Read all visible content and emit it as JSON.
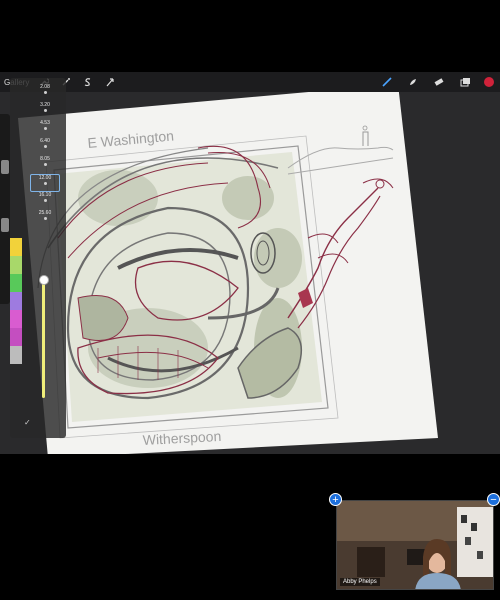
{
  "toolbar": {
    "gallery_label": "Gallery",
    "left_icons": [
      "wrench-icon",
      "magic-wand-icon",
      "selection-s-icon",
      "arrow-cursor-icon"
    ],
    "right_icons": [
      "brush-icon",
      "smudge-icon",
      "eraser-icon",
      "layers-icon"
    ],
    "active_color": "#d0223a"
  },
  "canvas": {
    "top_street_label": "E Washington",
    "bottom_street_label": "Witherspoon"
  },
  "brush_panel": {
    "sizes": [
      "2.08",
      "3.20",
      "4.53",
      "6.40",
      "8.05",
      "12.00",
      "16.10",
      "25.60"
    ],
    "selected_size": "12.00",
    "opacity_level": 0.95
  },
  "palette": {
    "colors": [
      "#f2d23a",
      "#a8d86a",
      "#58c95a",
      "#9e7be0",
      "#d95cd0",
      "#c44ec0",
      "#bcbcbc"
    ]
  },
  "video": {
    "participant_name": "Abby Phelps"
  }
}
